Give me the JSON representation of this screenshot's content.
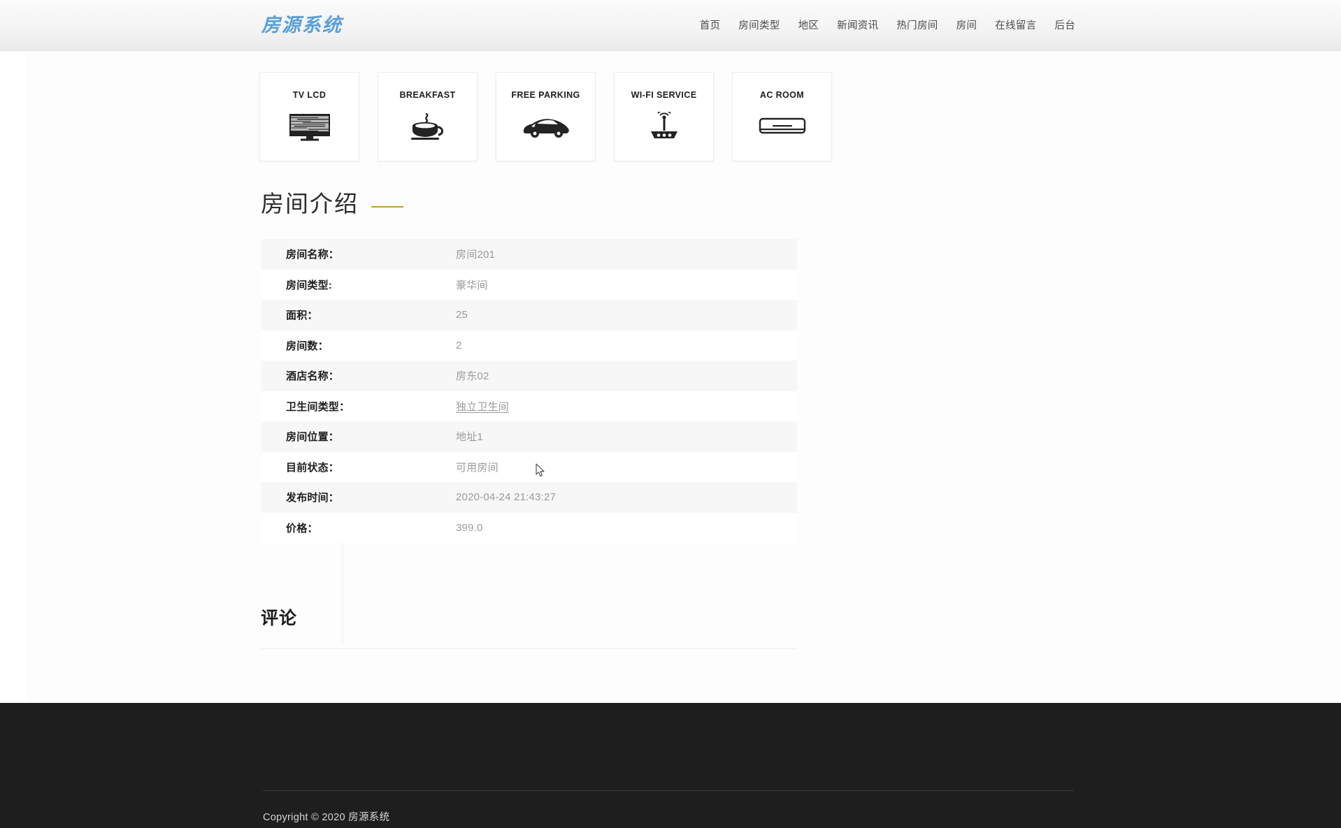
{
  "header": {
    "brand": "房源系统",
    "nav": [
      {
        "label": "首页",
        "name": "nav-home"
      },
      {
        "label": "房间类型",
        "name": "nav-room-type"
      },
      {
        "label": "地区",
        "name": "nav-region"
      },
      {
        "label": "新闻资讯",
        "name": "nav-news"
      },
      {
        "label": "热门房间",
        "name": "nav-hot-rooms"
      },
      {
        "label": "房间",
        "name": "nav-rooms"
      },
      {
        "label": "在线留言",
        "name": "nav-message"
      },
      {
        "label": "后台",
        "name": "nav-admin"
      }
    ]
  },
  "amenities": [
    {
      "title": "TV LCD",
      "icon": "tv-icon"
    },
    {
      "title": "BREAKFAST",
      "icon": "coffee-cup-icon"
    },
    {
      "title": "FREE PARKING",
      "icon": "car-icon"
    },
    {
      "title": "WI-FI SERVICE",
      "icon": "wifi-router-icon"
    },
    {
      "title": "AC ROOM",
      "icon": "air-conditioner-icon"
    }
  ],
  "section": {
    "title": "房间介绍",
    "accent_color": "#b6a33a"
  },
  "info_rows": [
    {
      "label": "房间名称：",
      "value": "房间201",
      "link": false
    },
    {
      "label": "房间类型:",
      "value": "豪华间",
      "link": false
    },
    {
      "label": "面积：",
      "value": "25",
      "link": false
    },
    {
      "label": "房间数：",
      "value": "2",
      "link": false
    },
    {
      "label": "酒店名称：",
      "value": "房东02",
      "link": false
    },
    {
      "label": "卫生间类型：",
      "value": "独立卫生间",
      "link": true
    },
    {
      "label": "房间位置：",
      "value": "地址1",
      "link": false
    },
    {
      "label": "目前状态：",
      "value": "可用房间",
      "link": false
    },
    {
      "label": "发布时间：",
      "value": "2020-04-24 21:43:27",
      "link": false
    },
    {
      "label": "价格：",
      "value": "399.0",
      "link": false
    }
  ],
  "comments": {
    "title": "评论"
  },
  "footer": {
    "copyright": "Copyright © 2020 房源系统"
  }
}
